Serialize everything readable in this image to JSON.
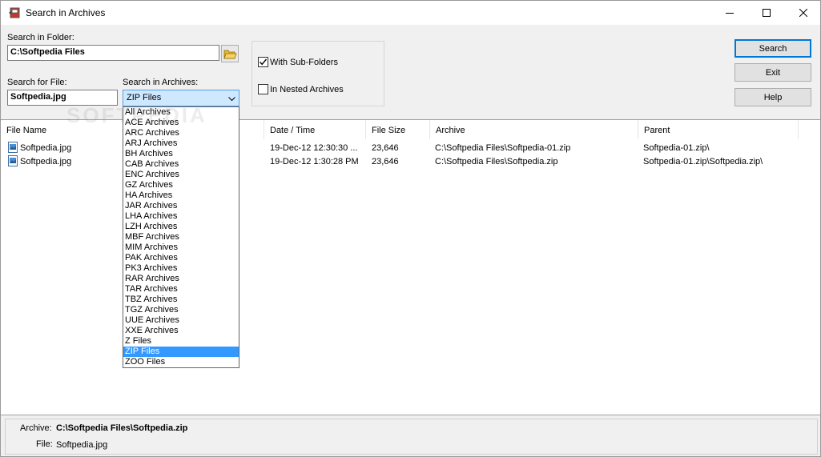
{
  "window": {
    "title": "Search in Archives",
    "controls": {
      "minimize": "minimize-icon",
      "maximize": "maximize-icon",
      "close": "close-icon"
    }
  },
  "search": {
    "folder_label": "Search in Folder:",
    "folder_value": "C:\\Softpedia Files",
    "file_label": "Search for File:",
    "file_value": "Softpedia.jpg",
    "archives_label": "Search in Archives:",
    "archives_selected": "ZIP Files"
  },
  "options": {
    "sub_folders": {
      "label": "With Sub-Folders",
      "checked": true
    },
    "nested": {
      "label": "In Nested Archives",
      "checked": false
    }
  },
  "buttons": {
    "search": "Search",
    "exit": "Exit",
    "help": "Help"
  },
  "dropdown": {
    "items": [
      "All Archives",
      "ACE Archives",
      "ARC Archives",
      "ARJ Archives",
      "BH Archives",
      "CAB Archives",
      "ENC Archives",
      "GZ Archives",
      "HA Archives",
      "JAR Archives",
      "LHA Archives",
      "LZH Archives",
      "MBF Archives",
      "MIM Archives",
      "PAK Archives",
      "PK3 Archives",
      "RAR Archives",
      "TAR Archives",
      "TBZ Archives",
      "TGZ Archives",
      "UUE Archives",
      "XXE Archives",
      "Z Files",
      "ZIP Files",
      "ZOO Files"
    ],
    "selected": "ZIP Files"
  },
  "results": {
    "columns": [
      "File Name",
      "Date / Time",
      "File Size",
      "Archive",
      "Parent"
    ],
    "rows": [
      {
        "name": "Softpedia.jpg",
        "date": "19-Dec-12 12:30:30 ...",
        "size": "23,646",
        "archive": "C:\\Softpedia Files\\Softpedia-01.zip",
        "parent": "Softpedia-01.zip\\"
      },
      {
        "name": "Softpedia.jpg",
        "date": "19-Dec-12 1:30:28 PM",
        "size": "23,646",
        "archive": "C:\\Softpedia Files\\Softpedia.zip",
        "parent": "Softpedia-01.zip\\Softpedia.zip\\"
      }
    ]
  },
  "status": {
    "archive_label": "Archive:",
    "archive_value": "C:\\Softpedia Files\\Softpedia.zip",
    "file_label": "File:",
    "file_value": "Softpedia.jpg"
  },
  "watermark": "SOFTPEDIA",
  "colors": {
    "selection": "#3399ff",
    "combo_bg": "#cde8ff",
    "default_button_border": "#0078d7"
  }
}
